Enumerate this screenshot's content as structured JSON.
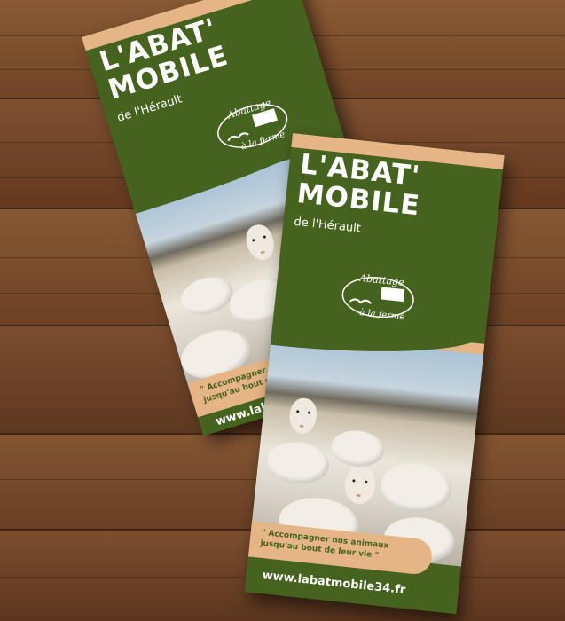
{
  "brochure": {
    "title_line1": "L'ABAT'",
    "title_line2": "MOBILE",
    "subtitle": "de l'Hérault",
    "logo_line1": "Abattage",
    "logo_line2": "à la ferme",
    "quote_line1": "\" Accompagner nos animaux",
    "quote_line2": "jusqu'au bout de leur vie \"",
    "website": "www.labatmobile34.fr"
  },
  "colors": {
    "brand_green": "#46621f",
    "accent_peach": "#e6b586",
    "wood": "#7a4d2d"
  }
}
